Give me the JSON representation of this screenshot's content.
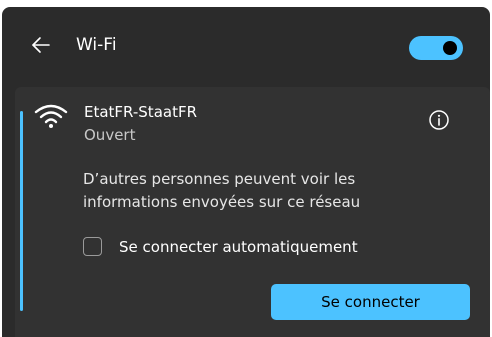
{
  "header": {
    "back_icon": "back-arrow-icon",
    "title": "Wi-Fi",
    "toggle_state": "on"
  },
  "network": {
    "icon": "wifi-icon",
    "name": "EtatFR-StaatFR",
    "status": "Ouvert",
    "info_icon": "info-icon",
    "warning_line1": "D’autres personnes peuvent voir les",
    "warning_line2": "informations envoyées sur ce réseau",
    "auto_connect_label": "Se connecter automatiquement",
    "auto_connect_checked": false,
    "connect_button_label": "Se connecter"
  },
  "colors": {
    "accent": "#4cc2ff",
    "background": "#2b2b2b",
    "card": "#323232"
  }
}
